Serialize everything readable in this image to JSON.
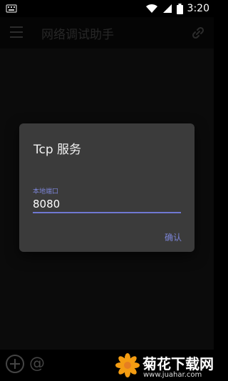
{
  "status_bar": {
    "time": "3:20",
    "icons": [
      "keyboard-icon",
      "wifi-icon",
      "signal-icon",
      "battery-icon"
    ]
  },
  "toolbar": {
    "title": "网络调试助手",
    "left_icon": "hamburger-icon",
    "right_icon": "link-icon"
  },
  "dialog": {
    "title": "Tcp 服务",
    "field_label": "本地端口",
    "field_value": "8080",
    "confirm_label": "确认"
  },
  "bottom_bar": {
    "icons": [
      "add-circle-icon",
      "at-icon"
    ],
    "at_symbol": "@"
  },
  "watermark": {
    "title": "菊花下载网",
    "url": "www.juahar.com"
  },
  "colors": {
    "accent": "#6f78d2",
    "dialog_bg": "#3b3b3b",
    "background": "#111111"
  }
}
